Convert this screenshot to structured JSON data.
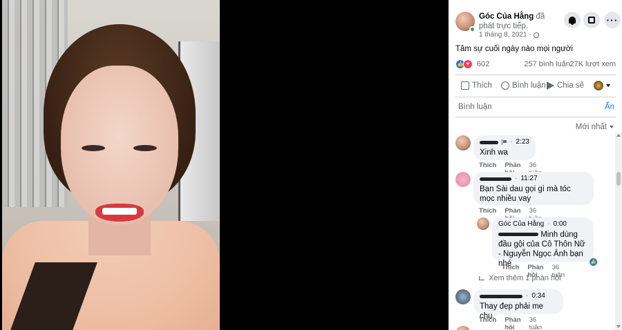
{
  "post": {
    "page_name": "Góc Của Hằng",
    "action_text": "đã phát trực tiếp.",
    "date": "1 tháng 8, 2021",
    "caption": "Tâm sự cuối ngày nào mọi người",
    "reaction_count": "602",
    "comment_count": "257 bình luận",
    "view_count": "27K lượt xem"
  },
  "actions": {
    "like": "Thích",
    "comment": "Bình luận",
    "share": "Chia sẻ"
  },
  "comment_box": {
    "placeholder": "Bình luận",
    "hide": "Ẩn"
  },
  "sort": {
    "label": "Mới nhất"
  },
  "comments": [
    {
      "time": "2:23",
      "text": "Xinh wa",
      "like": "Thích",
      "reply": "Phản hồi",
      "age": "36 tuần"
    },
    {
      "time": "11:27",
      "text": "Bạn Sài dau gọi gì mà tóc mọc nhiều vay",
      "like": "Thích",
      "reply": "Phản hồi",
      "age": "36 tuần"
    },
    {
      "time": "0:34",
      "text": "Thay đẹp phải me chu",
      "like": "Thích",
      "reply": "Phản hồi",
      "age": "36 tuần"
    }
  ],
  "reply": {
    "name": "Góc Của Hằng",
    "time": "0:00",
    "text": "Minh dùng đầu gội của Cô Thôn Nữ - Nguyễn Ngọc Ánh bạn nhé",
    "like": "Thích",
    "reply_label": "Phản hồi",
    "age": "36 tuần"
  },
  "more_replies": "Xem thêm 1 phản hồi",
  "colors": {
    "accent": "#1877f2",
    "bubble": "#f0f2f5",
    "love": "#f33e58"
  }
}
